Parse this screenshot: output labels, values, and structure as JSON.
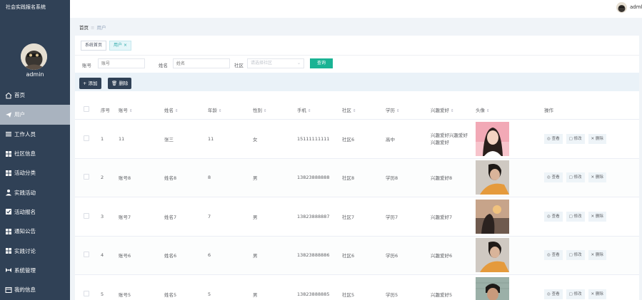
{
  "app": {
    "title": "社会实践报名系统",
    "admin_name": "admin",
    "header_user": "adml"
  },
  "colors": {
    "sidebar_bg": "#304156",
    "active_menu_bg": "#a9b3bf",
    "accent": "#1ab394",
    "tab_active": "#2aa8a8"
  },
  "menu": [
    {
      "label": "首页",
      "icon": "home-icon"
    },
    {
      "label": "用户",
      "icon": "paper-plane-icon",
      "active": true
    },
    {
      "label": "工作人员",
      "icon": "list-icon"
    },
    {
      "label": "社区信息",
      "icon": "grid-icon"
    },
    {
      "label": "活动分类",
      "icon": "grid-icon"
    },
    {
      "label": "实践活动",
      "icon": "person-icon"
    },
    {
      "label": "活动报名",
      "icon": "checkbox-icon"
    },
    {
      "label": "通知公告",
      "icon": "grid-icon"
    },
    {
      "label": "实践讨论",
      "icon": "grid-icon"
    },
    {
      "label": "系统管理",
      "icon": "wrench-icon"
    },
    {
      "label": "我的信息",
      "icon": "card-icon"
    }
  ],
  "breadcrumb": {
    "home": "首页",
    "sep": "≡",
    "current": "用户"
  },
  "tabs": [
    {
      "label": "系统首页"
    },
    {
      "label": "用户",
      "close": "×",
      "active": true
    }
  ],
  "search": {
    "account_label": "账号",
    "account_placeholder": "账号",
    "name_label": "姓名",
    "name_placeholder": "姓名",
    "community_label": "社区",
    "community_placeholder": "请选择社区",
    "search_button": "查询"
  },
  "actions": {
    "add": "+ 添加",
    "delete": "删除"
  },
  "table": {
    "columns": [
      "序号",
      "账号",
      "姓名",
      "年龄",
      "性别",
      "手机",
      "社区",
      "学历",
      "兴趣爱好",
      "头像",
      "操作"
    ],
    "sort_mark": "⇕",
    "ops": {
      "view": "查看",
      "edit": "修改",
      "delete": "删除"
    },
    "rows": [
      {
        "index": "1",
        "account": "11",
        "name": "张三",
        "age": "11",
        "gender": "女",
        "phone": "15111111111",
        "community": "社区6",
        "education": "高中",
        "hobby": "兴趣爱好兴趣爱好兴趣爱好"
      },
      {
        "index": "2",
        "account": "账号8",
        "name": "姓名8",
        "age": "8",
        "gender": "男",
        "phone": "13823888888",
        "community": "社区8",
        "education": "学历8",
        "hobby": "兴趣爱好8"
      },
      {
        "index": "3",
        "account": "账号7",
        "name": "姓名7",
        "age": "7",
        "gender": "男",
        "phone": "13823888887",
        "community": "社区7",
        "education": "学历7",
        "hobby": "兴趣爱好7"
      },
      {
        "index": "4",
        "account": "账号6",
        "name": "姓名6",
        "age": "6",
        "gender": "男",
        "phone": "13823888886",
        "community": "社区6",
        "education": "学历6",
        "hobby": "兴趣爱好6"
      },
      {
        "index": "5",
        "account": "账号5",
        "name": "姓名5",
        "age": "5",
        "gender": "男",
        "phone": "13823888885",
        "community": "社区5",
        "education": "学历5",
        "hobby": "兴趣爱好5"
      }
    ]
  }
}
